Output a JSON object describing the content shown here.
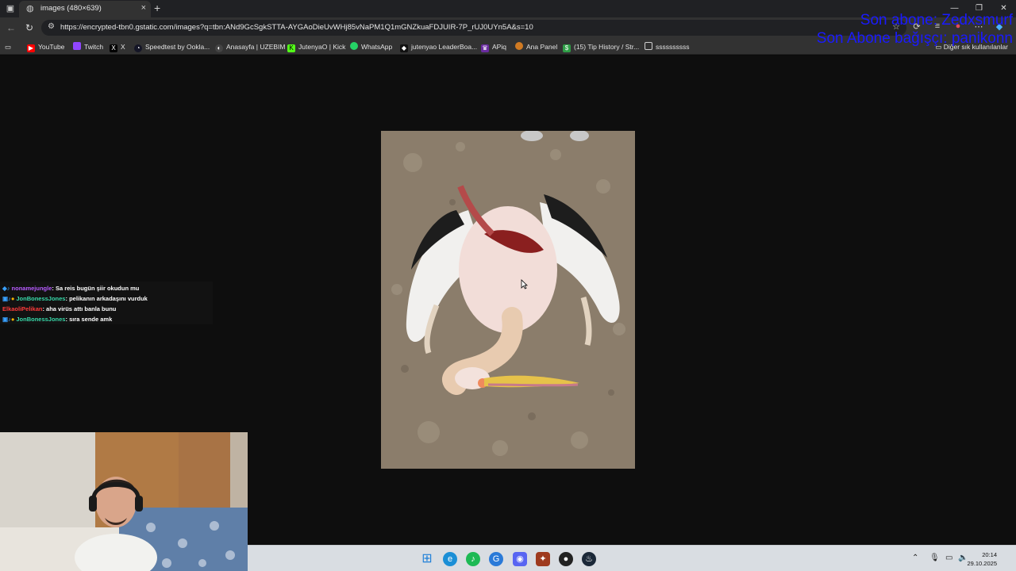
{
  "browser": {
    "tab": {
      "title": "images (480×639)",
      "close": "×"
    },
    "new_tab": "+",
    "window_controls": [
      "—",
      "❐",
      "✕"
    ],
    "url": "https://encrypted-tbn0.gstatic.com/images?q=tbn:ANd9GcSgkSTTA-AYGAoDieUvWHj85vNaPM1Q1mGNZkuaFDJUIR-7P_rUJ0UYn5A&s=10"
  },
  "bookmarks": [
    {
      "label": "YouTube",
      "icon": "youtube-icon",
      "color": "#ff0000"
    },
    {
      "label": "Twitch",
      "icon": "twitch-icon",
      "color": "#9146ff"
    },
    {
      "label": "X",
      "icon": "x-icon",
      "color": "#000000"
    },
    {
      "label": "Speedtest by Ookla...",
      "icon": "speedtest-icon",
      "color": "#141526"
    },
    {
      "label": "Anasayfa | UZEBIM",
      "icon": "uzebim-icon",
      "color": "#444444"
    },
    {
      "label": "JutenyaO | Kick",
      "icon": "kick-icon",
      "color": "#53fc18"
    },
    {
      "label": "WhatsApp",
      "icon": "whatsapp-icon",
      "color": "#25d366"
    },
    {
      "label": "jutenyao LeaderBoa...",
      "icon": "leaderboard-icon",
      "color": "#111111"
    },
    {
      "label": "APiq",
      "icon": "apiq-icon",
      "color": "#6a2ca0"
    },
    {
      "label": "Ana Panel",
      "icon": "panel-icon",
      "color": "#d07a22"
    },
    {
      "label": "(15) Tip History / Str...",
      "icon": "tip-icon",
      "color": "#2e9e46"
    },
    {
      "label": "ssssssssss",
      "icon": "folder-icon",
      "color": "#323232"
    }
  ],
  "bookmarks_other": "Diğer sık kullanılanlar",
  "overlay": {
    "line1": "Son abone: Zedxsmurf",
    "line2": "Son Abone bağışçı: panikonn"
  },
  "chat": [
    {
      "user": "nonamejungle",
      "user_color": "#b75cff",
      "message": ": Sa reis bugün şiir okudun mu"
    },
    {
      "user": "JonBonessJones",
      "user_color": "#38d9a9",
      "message": ": pelikanın arkadaşını vurduk"
    },
    {
      "user": "ElkaoliPelikan",
      "user_color": "#ff3b3b",
      "message": ": aha virüs attı banla bunu"
    },
    {
      "user": "JonBonessJones",
      "user_color": "#38d9a9",
      "message": ": sıra sende amk"
    }
  ],
  "taskbar": {
    "apps": [
      {
        "name": "start-icon",
        "color": "#1e7fd8",
        "glyph": "⊞"
      },
      {
        "name": "edge-icon",
        "color": "#1b8fd6",
        "glyph": "e"
      },
      {
        "name": "spotify-icon",
        "color": "#1db954",
        "glyph": "♪"
      },
      {
        "name": "browser-icon",
        "color": "#2a7ad8",
        "glyph": "G"
      },
      {
        "name": "discord-icon",
        "color": "#5865f2",
        "glyph": "◉"
      },
      {
        "name": "game-icon",
        "color": "#9e3a1e",
        "glyph": "✦"
      },
      {
        "name": "app-icon",
        "color": "#222222",
        "glyph": "●"
      },
      {
        "name": "steam-icon",
        "color": "#1b2838",
        "glyph": "♨"
      }
    ],
    "time": "20:14",
    "date": "29.10.2025"
  }
}
